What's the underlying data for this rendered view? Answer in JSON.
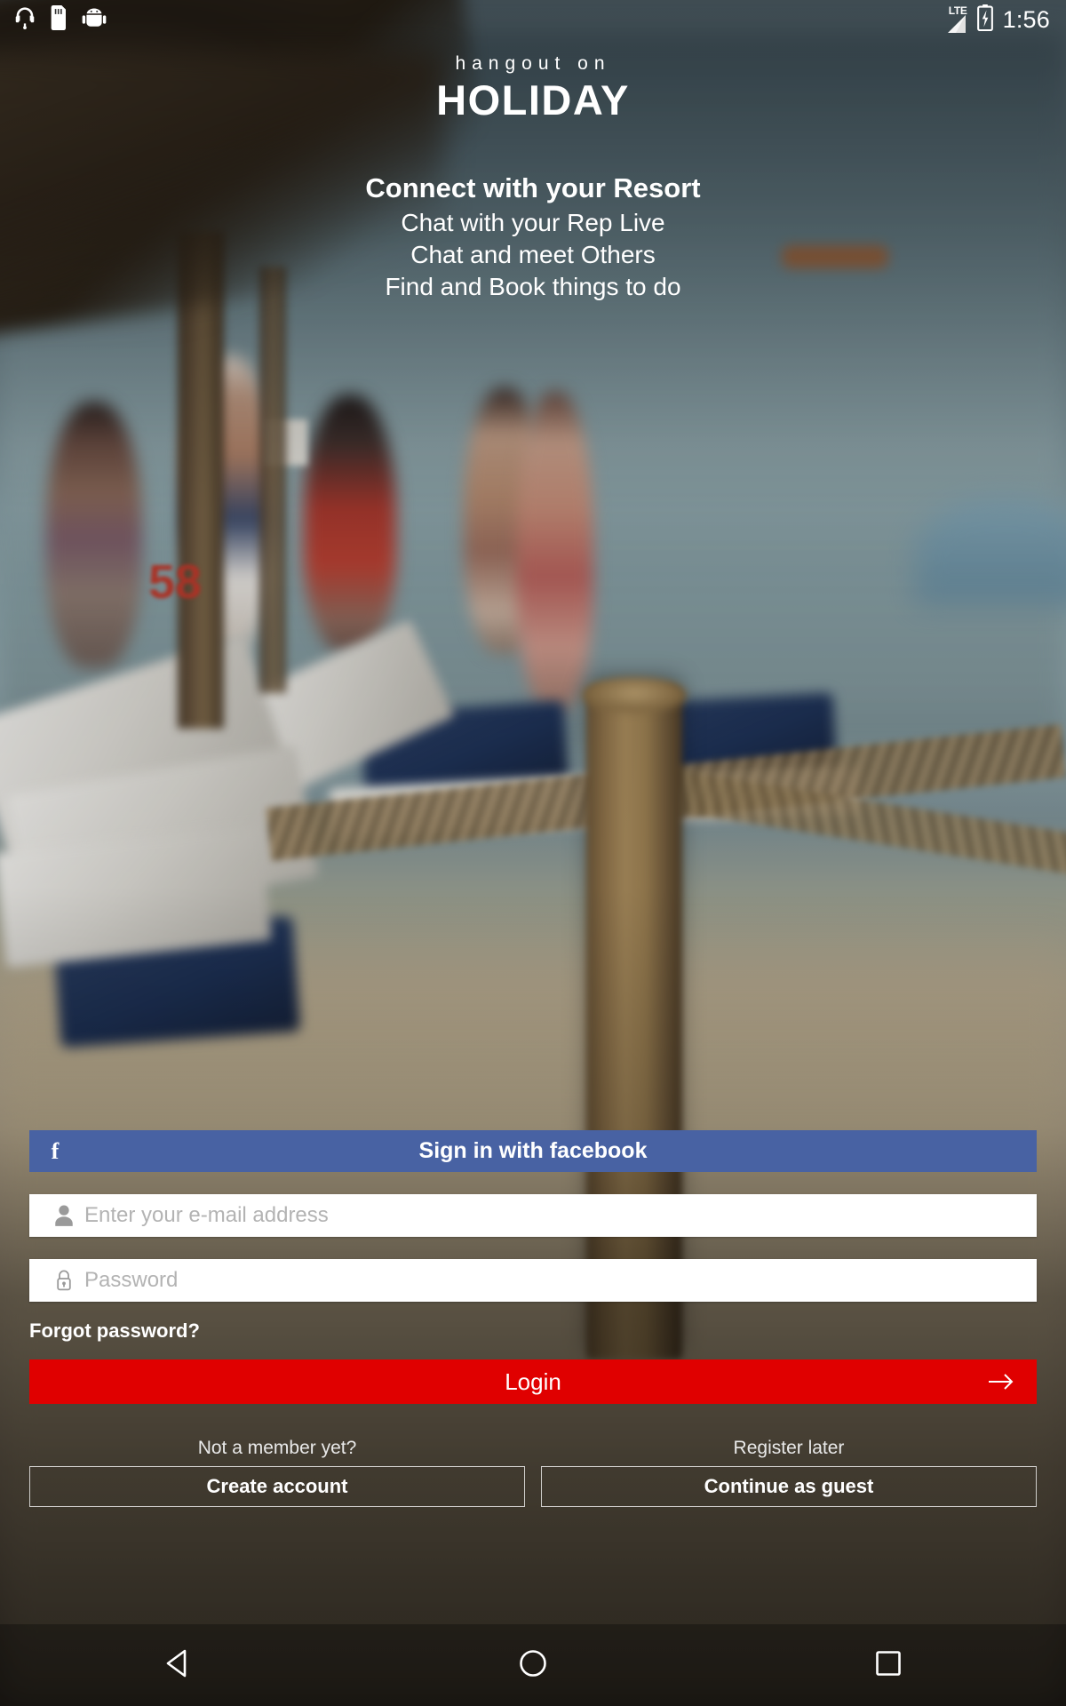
{
  "status_bar": {
    "time": "1:56",
    "network_label": "LTE",
    "left_icons": [
      "headset-icon",
      "sd-card-icon",
      "android-debug-icon"
    ],
    "right_icons": [
      "lte-signal-icon",
      "battery-charging-icon"
    ]
  },
  "brand": {
    "tagline_small": "hangout on",
    "name": "HOLIDAY"
  },
  "tagline": {
    "line1": "Connect with your Resort",
    "line2": "Chat with your Rep Live",
    "line3": "Chat and meet Others",
    "line4": "Find and Book things to do"
  },
  "form": {
    "facebook_button": {
      "label": "Sign in with facebook",
      "icon": "facebook-f-icon",
      "color": "#4862a3"
    },
    "email": {
      "placeholder": "Enter your e-mail address",
      "value": "",
      "icon": "person-icon"
    },
    "password": {
      "placeholder": "Password",
      "value": "",
      "icon": "lock-icon"
    },
    "forgot_password": "Forgot password?",
    "login_button": {
      "label": "Login",
      "icon": "arrow-right-icon",
      "color": "#e00000"
    }
  },
  "alternatives": {
    "create": {
      "hint": "Not a member yet?",
      "button": "Create account"
    },
    "guest": {
      "hint": "Register later",
      "button": "Continue as guest"
    }
  },
  "nav_bar": {
    "back": "back-triangle-icon",
    "home": "home-circle-icon",
    "recents": "recents-square-icon"
  }
}
